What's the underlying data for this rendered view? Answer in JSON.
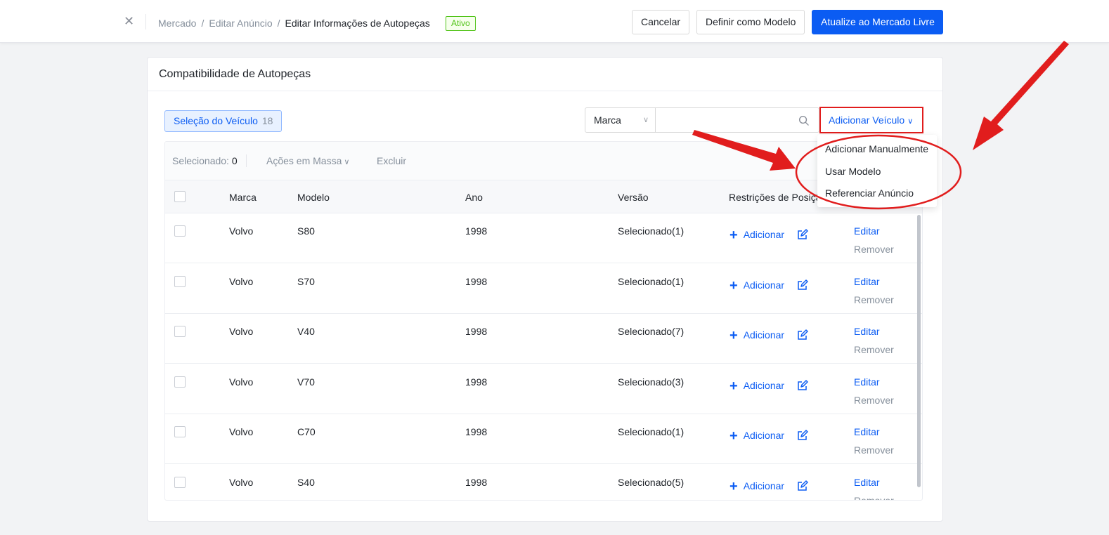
{
  "header": {
    "breadcrumb": [
      "Mercado",
      "Editar Anúncio",
      "Editar Informações de Autopeças"
    ],
    "breadcrumb_separator": "/",
    "status_badge": "Ativo",
    "buttons": {
      "cancel": "Cancelar",
      "set_template": "Definir como Modelo",
      "update": "Atualize ao Mercado Livre"
    }
  },
  "card": {
    "title": "Compatibilidade de Autopeças",
    "vehicle_tab": {
      "label": "Seleção do Veículo",
      "count": "18"
    },
    "brand_select": {
      "value": "Marca"
    },
    "search": {
      "value": ""
    },
    "add_vehicle": {
      "label": "Adicionar Veículo"
    },
    "dropdown_items": [
      "Adicionar Manualmente",
      "Usar Modelo",
      "Referenciar Anúncio"
    ]
  },
  "toolbar": {
    "selected_label": "Selecionado:",
    "selected_count": "0",
    "bulk_actions": "Ações em Massa",
    "delete": "Excluir"
  },
  "table": {
    "columns": {
      "brand": "Marca",
      "model": "Modelo",
      "year": "Ano",
      "version": "Versão",
      "position": "Restrições de Posição"
    },
    "add_label": "Adicionar",
    "edit_label": "Editar",
    "remove_label": "Remover",
    "rows": [
      {
        "brand": "Volvo",
        "model": "S80",
        "year": "1998",
        "version": "Selecionado(1)"
      },
      {
        "brand": "Volvo",
        "model": "S70",
        "year": "1998",
        "version": "Selecionado(1)"
      },
      {
        "brand": "Volvo",
        "model": "V40",
        "year": "1998",
        "version": "Selecionado(7)"
      },
      {
        "brand": "Volvo",
        "model": "V70",
        "year": "1998",
        "version": "Selecionado(3)"
      },
      {
        "brand": "Volvo",
        "model": "C70",
        "year": "1998",
        "version": "Selecionado(1)"
      },
      {
        "brand": "Volvo",
        "model": "S40",
        "year": "1998",
        "version": "Selecionado(5)"
      }
    ]
  },
  "colors": {
    "primary": "#0b5cf3",
    "annotation_red": "#e11d1d",
    "status_green": "#52c41a"
  },
  "icons": [
    "close-icon",
    "chevron-down-icon",
    "search-icon",
    "plus-icon",
    "edit-icon"
  ]
}
